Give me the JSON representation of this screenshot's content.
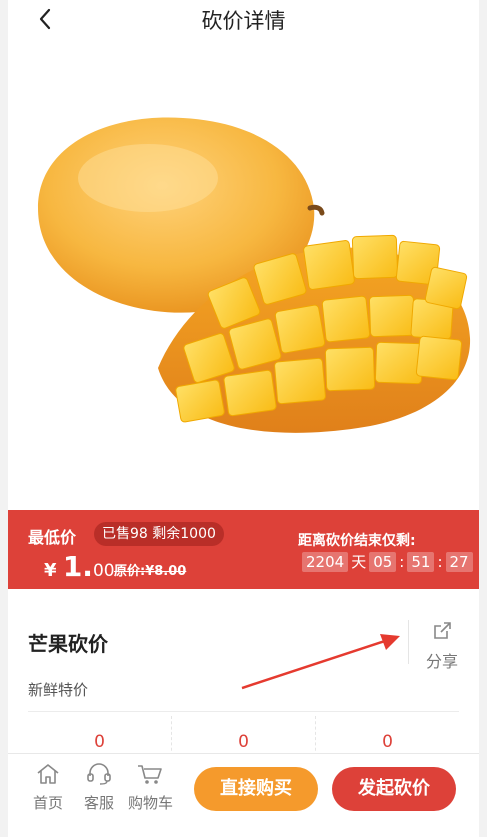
{
  "header": {
    "title": "砍价详情",
    "back_icon": "back-arrow-icon"
  },
  "colors": {
    "accent_red": "#dd4139",
    "buy_orange": "#f59a2c"
  },
  "price_banner": {
    "lowest_label": "最低价",
    "sold_badge": "已售98 剩余1000",
    "currency": "¥",
    "price_int": "1",
    "price_dot": ".",
    "price_dec": "00",
    "original_label": "原价:",
    "original_value": "¥8.00",
    "countdown_label": "距离砍价结束仅剩:",
    "countdown": {
      "days": "2204",
      "day_unit": "天",
      "hours": "05",
      "minutes": "51",
      "seconds": "27",
      "sep": ":"
    }
  },
  "product": {
    "name": "芒果砍价",
    "subtitle": "新鲜特价"
  },
  "share": {
    "label": "分享",
    "icon": "share-icon"
  },
  "stats": [
    "0",
    "0",
    "0"
  ],
  "bottom_nav": {
    "items": [
      {
        "label": "首页",
        "icon": "home-icon"
      },
      {
        "label": "客服",
        "icon": "headset-icon"
      },
      {
        "label": "购物车",
        "icon": "cart-icon"
      }
    ],
    "buy_label": "直接购买",
    "bargain_label": "发起砍价"
  }
}
